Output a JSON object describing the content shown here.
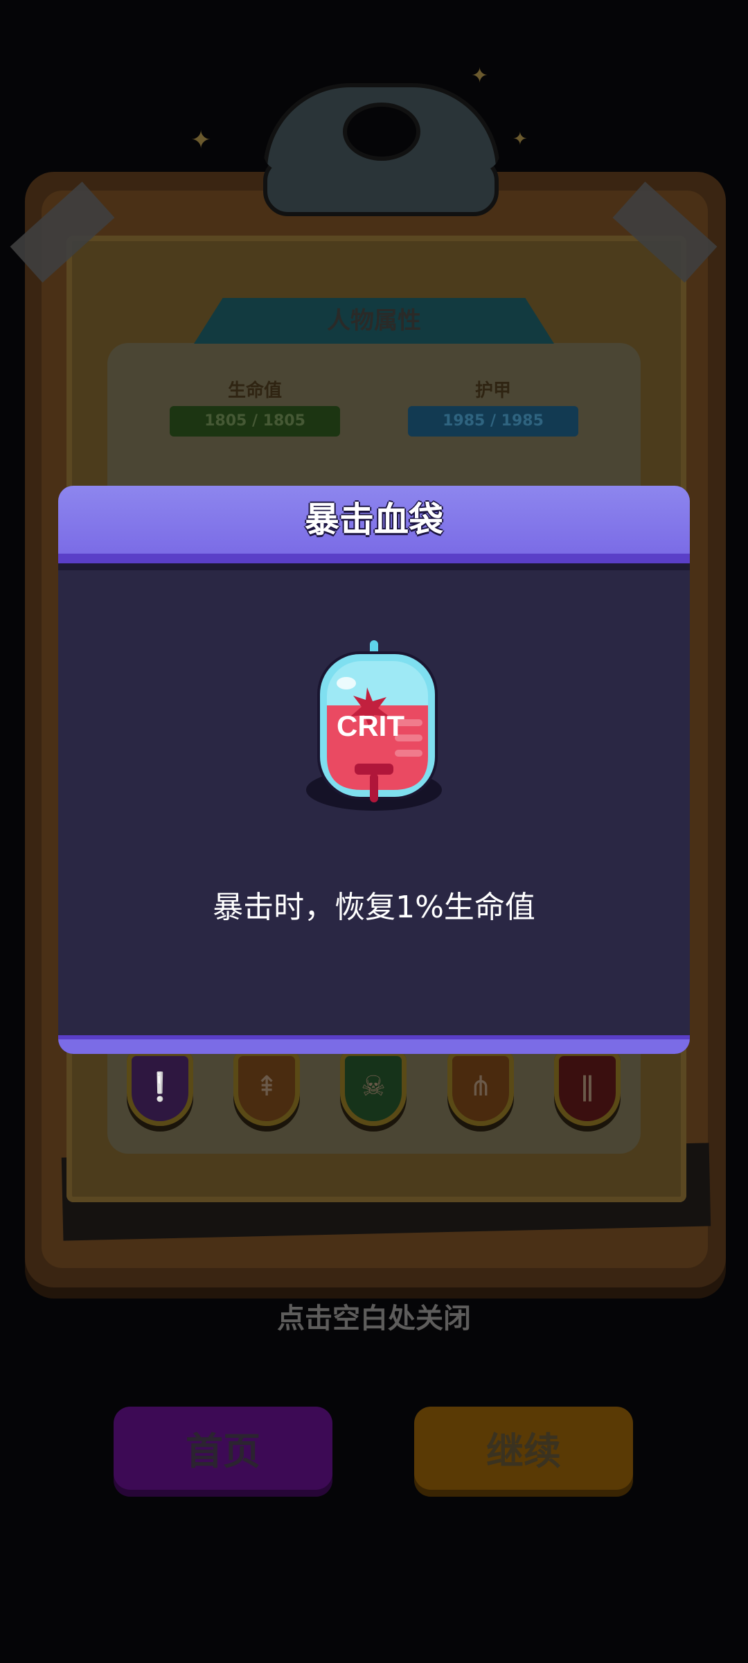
{
  "background": {
    "attributes_title": "人物属性",
    "stats": [
      {
        "label": "生命值",
        "value": "1805 / 1805"
      },
      {
        "label": "护甲",
        "value": "1985 / 1985"
      }
    ],
    "close_hint": "点击空白处关闭"
  },
  "modal": {
    "title": "暴击血袋",
    "icon_text": "CRIT",
    "description": "暴击时，恢复1%生命值"
  },
  "buttons": {
    "home": "首页",
    "continue": "继续"
  },
  "colors": {
    "modal_header": "#8d86ee",
    "modal_body": "#2a2744",
    "home_button": "#3d0a55",
    "continue_button": "#5a3a05"
  }
}
